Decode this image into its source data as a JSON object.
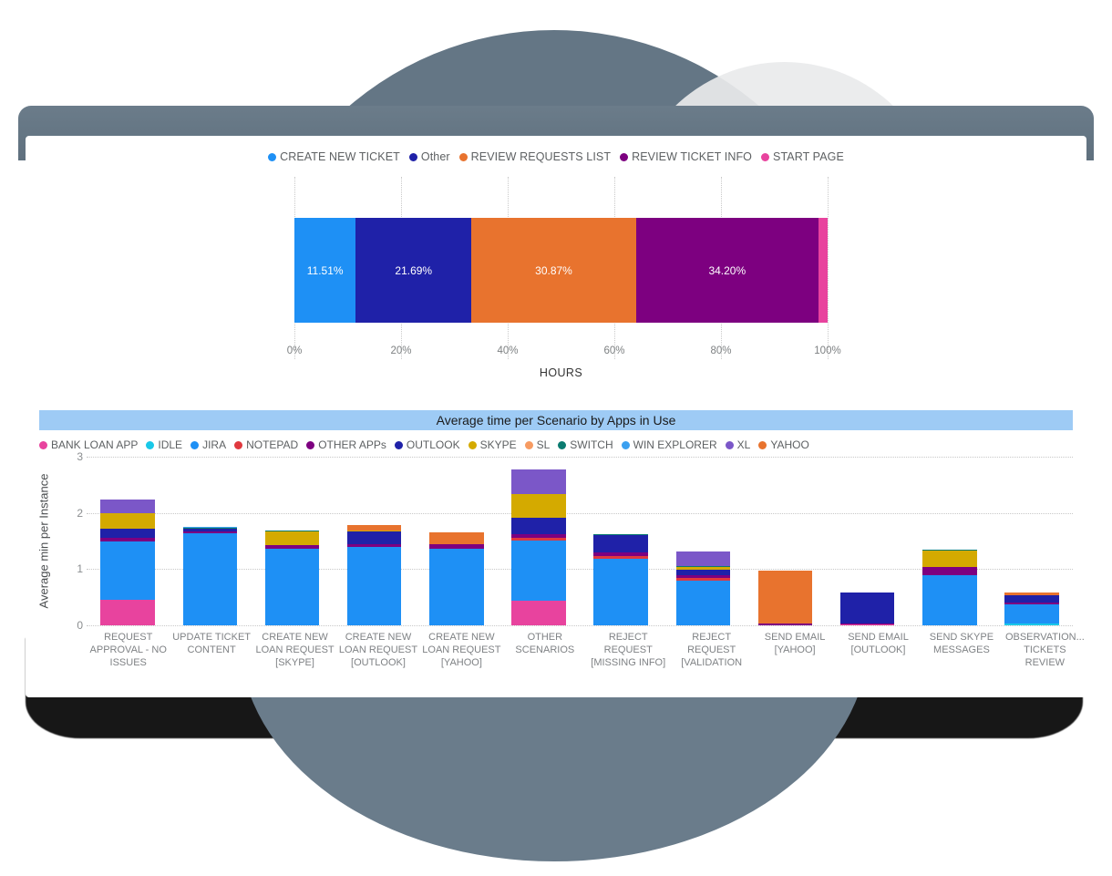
{
  "chart_data": [
    {
      "type": "bar",
      "orientation": "horizontal",
      "stacked": true,
      "title": "",
      "xlabel": "HOURS",
      "ylabel": "",
      "xlim": [
        0,
        100
      ],
      "xticks": [
        "0%",
        "20%",
        "40%",
        "60%",
        "80%",
        "100%"
      ],
      "grid": true,
      "legend_position": "top",
      "categories": [
        "CREATE NEW TICKET",
        "Other",
        "REVIEW REQUESTS LIST",
        "REVIEW TICKET INFO",
        "START PAGE"
      ],
      "values": [
        11.51,
        21.69,
        30.87,
        34.2,
        1.73
      ],
      "data_labels": [
        "11.51%",
        "21.69%",
        "30.87%",
        "34.20%",
        ""
      ],
      "colors": [
        "#1e90f5",
        "#1f21a8",
        "#e8732e",
        "#7d0080",
        "#e8439e"
      ]
    },
    {
      "type": "bar",
      "orientation": "vertical",
      "stacked": true,
      "title": "Average time per Scenario by Apps in Use",
      "xlabel": "",
      "ylabel": "Average min per Instance",
      "ylim": [
        0,
        3
      ],
      "yticks": [
        "0",
        "1",
        "2",
        "3"
      ],
      "grid": true,
      "legend_position": "top-left",
      "categories": [
        "REQUEST\nAPPROVAL - NO\nISSUES",
        "UPDATE TICKET\nCONTENT",
        "CREATE NEW\nLOAN REQUEST\n[SKYPE]",
        "CREATE NEW\nLOAN REQUEST\n[OUTLOOK]",
        "CREATE NEW\nLOAN REQUEST\n[YAHOO]",
        "OTHER\nSCENARIOS",
        "REJECT\nREQUEST\n[MISSING INFO]",
        "REJECT\nREQUEST\n[VALIDATION",
        "SEND EMAIL\n[YAHOO]",
        "SEND EMAIL\n[OUTLOOK]",
        "SEND SKYPE\nMESSAGES",
        "OBSERVATION...\nTICKETS REVIEW"
      ],
      "series": [
        {
          "name": "BANK LOAN APP",
          "color": "#e8439e",
          "values": [
            0.46,
            0,
            0,
            0,
            0,
            0.44,
            0,
            0,
            0,
            0.01,
            0,
            0
          ]
        },
        {
          "name": "IDLE",
          "color": "#19c8e8",
          "values": [
            0,
            0,
            0,
            0,
            0,
            0,
            0,
            0,
            0,
            0,
            0,
            0.04
          ]
        },
        {
          "name": "JIRA",
          "color": "#1e90f5",
          "values": [
            1.03,
            1.63,
            1.37,
            1.39,
            1.37,
            1.07,
            1.18,
            0.8,
            0,
            0,
            0.9,
            0.34
          ]
        },
        {
          "name": "NOTEPAD",
          "color": "#e0393f",
          "values": [
            0,
            0,
            0,
            0,
            0,
            0.04,
            0.06,
            0.04,
            0,
            0,
            0,
            0
          ]
        },
        {
          "name": "OTHER APPs",
          "color": "#7d0080",
          "values": [
            0.06,
            0.04,
            0.05,
            0.06,
            0.07,
            0.07,
            0.05,
            0.06,
            0.03,
            0.02,
            0.13,
            0.03
          ]
        },
        {
          "name": "OUTLOOK",
          "color": "#1f21a8",
          "values": [
            0.17,
            0.05,
            0,
            0.22,
            0,
            0.3,
            0.31,
            0.09,
            0,
            0.55,
            0,
            0.12
          ]
        },
        {
          "name": "SKYPE",
          "color": "#d4aa00",
          "values": [
            0.28,
            0,
            0.25,
            0.01,
            0,
            0.41,
            0,
            0.05,
            0,
            0,
            0.3,
            0
          ]
        },
        {
          "name": "SL",
          "color": "#f79b62",
          "values": [
            0,
            0,
            0,
            0,
            0,
            0,
            0,
            0,
            0,
            0,
            0,
            0.01
          ]
        },
        {
          "name": "SWITCH",
          "color": "#0a7b70",
          "values": [
            0,
            0.01,
            0.02,
            0.01,
            0,
            0,
            0.02,
            0.01,
            0,
            0,
            0.01,
            0
          ]
        },
        {
          "name": "WIN EXPLORER",
          "color": "#3ba0f0",
          "values": [
            0,
            0.02,
            0,
            0,
            0,
            0,
            0,
            0,
            0,
            0,
            0,
            0
          ]
        },
        {
          "name": "XL",
          "color": "#7b57c8",
          "values": [
            0.24,
            0,
            0,
            0,
            0,
            0.45,
            0,
            0.26,
            0,
            0,
            0,
            0
          ]
        },
        {
          "name": "YAHOO",
          "color": "#e8732e",
          "values": [
            0,
            0,
            0,
            0.09,
            0.21,
            0,
            0,
            0,
            0.94,
            0,
            0,
            0.04
          ]
        }
      ]
    }
  ],
  "top_chart": {
    "legend": [
      {
        "label": "CREATE NEW TICKET",
        "color": "#1e90f5"
      },
      {
        "label": "Other",
        "color": "#1f21a8"
      },
      {
        "label": "REVIEW REQUESTS LIST",
        "color": "#e8732e"
      },
      {
        "label": "REVIEW TICKET INFO",
        "color": "#7d0080"
      },
      {
        "label": "START PAGE",
        "color": "#e8439e"
      }
    ],
    "axis_title": "HOURS",
    "xticks": [
      "0%",
      "20%",
      "40%",
      "60%",
      "80%",
      "100%"
    ]
  },
  "bottom_chart": {
    "title": "Average time per Scenario by Apps in Use",
    "ylabel": "Average min per Instance",
    "yticks": [
      "3",
      "2",
      "1",
      "0"
    ]
  },
  "colors": {
    "bank_loan_app": "#e8439e",
    "idle": "#19c8e8",
    "jira": "#1e90f5",
    "notepad": "#e0393f",
    "other_apps": "#7d0080",
    "outlook": "#1f21a8",
    "skype": "#d4aa00",
    "sl": "#f79b62",
    "switch": "#0a7b70",
    "win_explorer": "#3ba0f0",
    "xl": "#7b57c8",
    "yahoo": "#e8732e",
    "title_band": "#9ecbf5",
    "frame": "#647685"
  }
}
